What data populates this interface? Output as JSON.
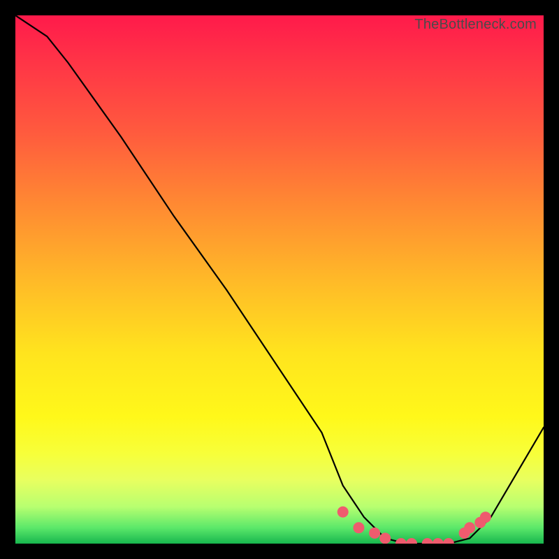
{
  "attribution": "TheBottleneck.com",
  "chart_data": {
    "type": "line",
    "title": "",
    "xlabel": "",
    "ylabel": "",
    "xlim": [
      0,
      100
    ],
    "ylim": [
      0,
      100
    ],
    "series": [
      {
        "name": "bottleneck-curve",
        "x": [
          0,
          6,
          10,
          20,
          30,
          40,
          50,
          58,
          62,
          66,
          70,
          74,
          78,
          82,
          86,
          90,
          100
        ],
        "values": [
          100,
          96,
          91,
          77,
          62,
          48,
          33,
          21,
          11,
          5,
          1,
          0,
          0,
          0,
          1,
          5,
          22
        ]
      }
    ],
    "markers": {
      "name": "highlight-points",
      "x": [
        62,
        65,
        68,
        70,
        73,
        75,
        78,
        80,
        82,
        85,
        86,
        88,
        89
      ],
      "values": [
        6,
        3,
        2,
        1,
        0,
        0,
        0,
        0,
        0,
        2,
        3,
        4,
        5
      ],
      "color": "#ef5b6e",
      "radius": 8
    }
  }
}
